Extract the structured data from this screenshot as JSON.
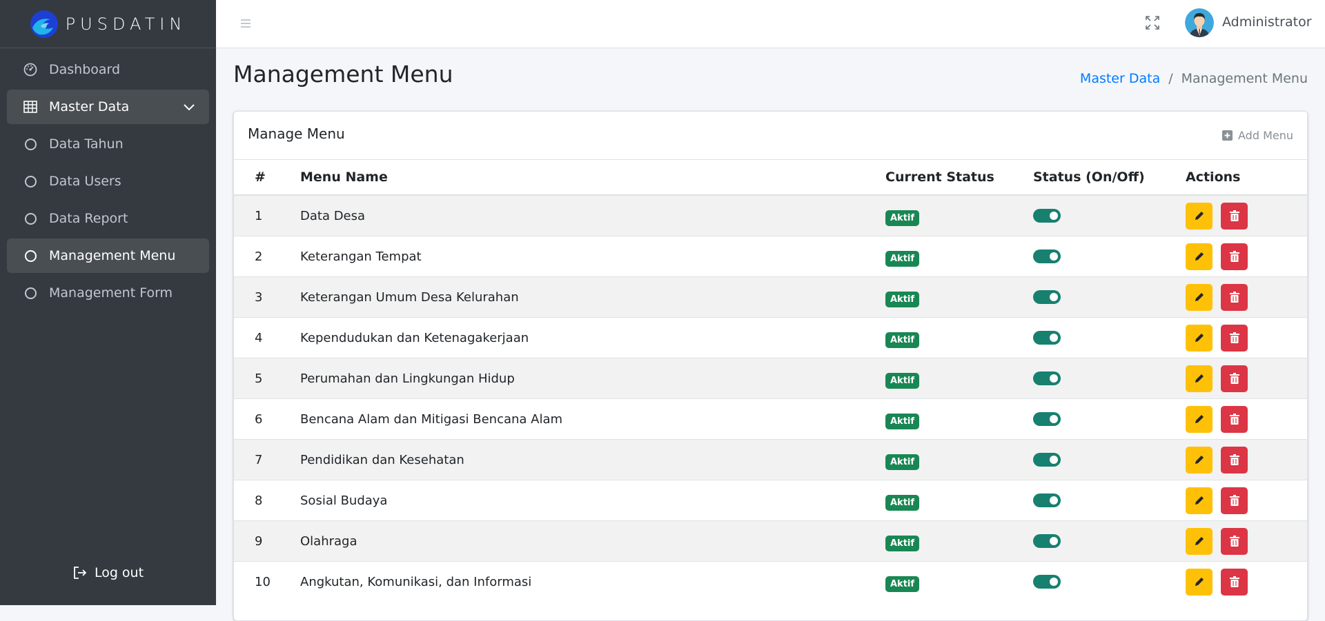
{
  "brand": {
    "name": "PUSDATIN"
  },
  "sidebar": {
    "items": [
      {
        "label": "Dashboard",
        "icon": "dashboard-gauge-icon"
      },
      {
        "label": "Master Data",
        "icon": "table-grid-icon"
      },
      {
        "label": "Data Tahun",
        "icon": "circle-icon"
      },
      {
        "label": "Data Users",
        "icon": "circle-icon"
      },
      {
        "label": "Data Report",
        "icon": "circle-icon"
      },
      {
        "label": "Management Menu",
        "icon": "circle-icon"
      },
      {
        "label": "Management Form",
        "icon": "circle-icon"
      }
    ],
    "logout_label": "Log out"
  },
  "topbar": {
    "user_name": "Administrator"
  },
  "page": {
    "title": "Management Menu",
    "breadcrumb": [
      "Master Data",
      "Management Menu"
    ]
  },
  "card": {
    "title": "Manage Menu",
    "add_label": "Add Menu",
    "columns": [
      "#",
      "Menu Name",
      "Current Status",
      "Status (On/Off)",
      "Actions"
    ],
    "rows": [
      {
        "no": "1",
        "name": "Data Desa",
        "status": "Aktif",
        "on": true
      },
      {
        "no": "2",
        "name": "Keterangan Tempat",
        "status": "Aktif",
        "on": true
      },
      {
        "no": "3",
        "name": "Keterangan Umum Desa Kelurahan",
        "status": "Aktif",
        "on": true
      },
      {
        "no": "4",
        "name": "Kependudukan dan Ketenagakerjaan",
        "status": "Aktif",
        "on": true
      },
      {
        "no": "5",
        "name": "Perumahan dan Lingkungan Hidup",
        "status": "Aktif",
        "on": true
      },
      {
        "no": "6",
        "name": "Bencana Alam dan Mitigasi Bencana Alam",
        "status": "Aktif",
        "on": true
      },
      {
        "no": "7",
        "name": "Pendidikan dan Kesehatan",
        "status": "Aktif",
        "on": true
      },
      {
        "no": "8",
        "name": "Sosial Budaya",
        "status": "Aktif",
        "on": true
      },
      {
        "no": "9",
        "name": "Olahraga",
        "status": "Aktif",
        "on": true
      },
      {
        "no": "10",
        "name": "Angkutan, Komunikasi, dan Informasi",
        "status": "Aktif",
        "on": true
      }
    ]
  },
  "colors": {
    "sidebar_bg": "#343a40",
    "active_item_bg": "#494e53",
    "badge_green": "#198754",
    "toggle_on": "#17806f",
    "edit_yellow": "#ffc107",
    "delete_red": "#dc3545",
    "link_blue": "#007bff"
  }
}
